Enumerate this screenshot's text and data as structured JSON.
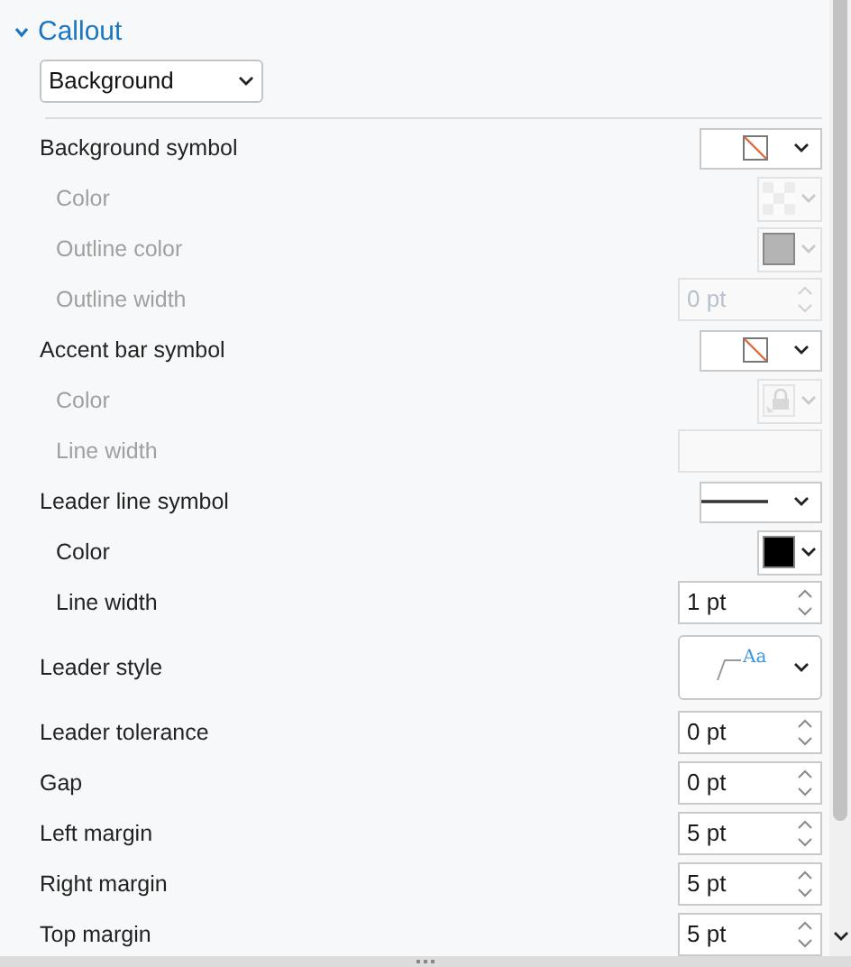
{
  "sections": [
    {
      "label": "Callout",
      "expanded": true
    }
  ],
  "mode_dropdown": {
    "value": "Background"
  },
  "rows": [
    {
      "label": "Background symbol",
      "kind": "symbol",
      "symbol": {
        "kind": "none"
      },
      "disabled": false,
      "indented": false
    },
    {
      "label": "Color",
      "kind": "color",
      "swatch": {
        "kind": "checker"
      },
      "disabled": true,
      "indented": true
    },
    {
      "label": "Outline color",
      "kind": "color",
      "swatch": {
        "kind": "solid",
        "color": "#b4b4b4"
      },
      "disabled": true,
      "indented": true
    },
    {
      "label": "Outline width",
      "kind": "spin",
      "value": "0 pt",
      "disabled": true,
      "indented": true
    },
    {
      "label": "Accent bar symbol",
      "kind": "symbol",
      "symbol": {
        "kind": "none"
      },
      "disabled": false,
      "indented": false
    },
    {
      "label": "Color",
      "kind": "color",
      "swatch": {
        "kind": "locked"
      },
      "disabled": true,
      "indented": true
    },
    {
      "label": "Line width",
      "kind": "blank",
      "disabled": true,
      "indented": true
    },
    {
      "label": "Leader line symbol",
      "kind": "symbol",
      "symbol": {
        "kind": "line"
      },
      "disabled": false,
      "indented": false
    },
    {
      "label": "Color",
      "kind": "color",
      "swatch": {
        "kind": "solid",
        "color": "#000000"
      },
      "disabled": false,
      "indented": true
    },
    {
      "label": "Line width",
      "kind": "spin",
      "value": "1 pt",
      "disabled": false,
      "indented": true
    },
    {
      "label": "Leader style",
      "kind": "leader",
      "sample": "Aa",
      "disabled": false,
      "indented": false
    },
    {
      "label": "Leader tolerance",
      "kind": "spin",
      "value": "0 pt",
      "disabled": false,
      "indented": false
    },
    {
      "label": "Gap",
      "kind": "spin",
      "value": "0 pt",
      "disabled": false,
      "indented": false
    },
    {
      "label": "Left margin",
      "kind": "spin",
      "value": "5 pt",
      "disabled": false,
      "indented": false
    },
    {
      "label": "Right margin",
      "kind": "spin",
      "value": "5 pt",
      "disabled": false,
      "indented": false
    },
    {
      "label": "Top margin",
      "kind": "spin",
      "value": "5 pt",
      "disabled": false,
      "indented": false
    }
  ]
}
